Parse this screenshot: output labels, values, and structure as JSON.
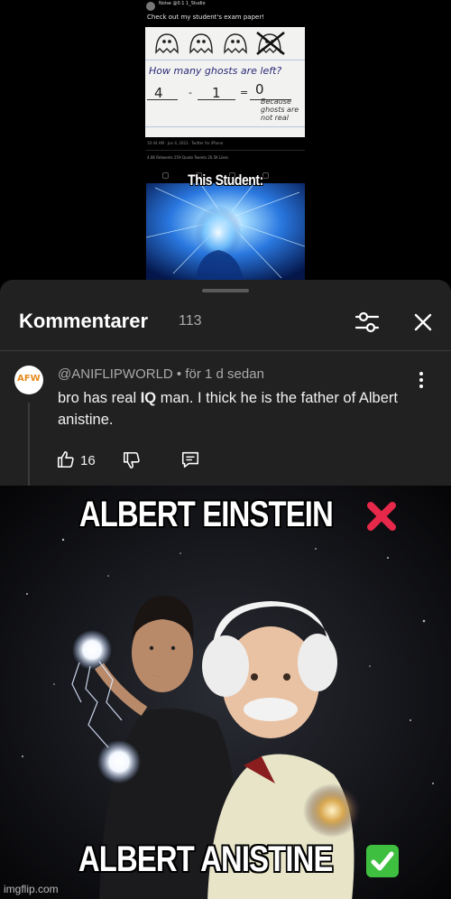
{
  "tweet": {
    "author": "Noise",
    "handle": "@0.1 1_Studio",
    "text": "Check out my student's exam paper!",
    "exam": {
      "question": "How many ghosts are left?",
      "a": "4",
      "b": "1",
      "result": "0",
      "op_minus": "-",
      "op_equals": "=",
      "reason": "Because ghosts are not real"
    },
    "meta": "10:44 AM · Jun 4, 2023 · Twitter for iPhone",
    "stats": "4.6K Retweets   259 Quote Tweets   20.5K Likes"
  },
  "brain_caption": "This Student:",
  "comments_sheet": {
    "title": "Kommentarer",
    "count": "113",
    "comment": {
      "avatar_text": "AFW",
      "author": "@ANIFLIPWORLD",
      "time": "för 1 d sedan",
      "text_before": "bro has real ",
      "text_bold": "IQ",
      "text_after": " man. I thick he is the father of Albert anistine.",
      "likes": "16"
    }
  },
  "meme": {
    "top_caption": "ALBERT EINSTEIN",
    "bottom_caption": "ALBERT ANISTINE",
    "top_mark": "cross-mark-icon",
    "bottom_mark": "check-mark-icon",
    "watermark": "imgflip.com"
  },
  "colors": {
    "sheet_bg": "#212121",
    "cross_red": "#e6284a",
    "check_green": "#3fbf3f"
  }
}
